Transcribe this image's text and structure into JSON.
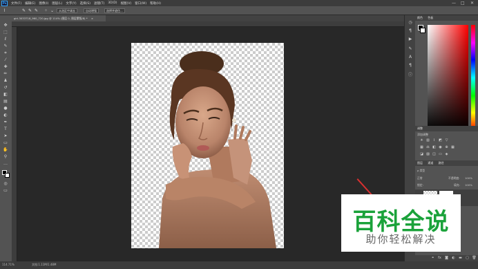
{
  "app": {
    "logo": "Ps",
    "menu": [
      "文件(F)",
      "编辑(E)",
      "图像(I)",
      "图层(L)",
      "文字(Y)",
      "选择(S)",
      "滤镜(T)",
      "3D(D)",
      "视图(V)",
      "窗口(W)",
      "帮助(H)"
    ],
    "window_controls": [
      "—",
      "□",
      "✕"
    ]
  },
  "options_bar": {
    "feather_label": "羽化:",
    "btn_subtract": "从选区中减去",
    "btn_auto": "自动增强",
    "btn_refine": "选择并遮住..."
  },
  "document": {
    "tab_label": "girl-3033718_960_720.jpg @ 114% (图层 0, 图层蒙版/8) *",
    "tab_close": "×"
  },
  "status": {
    "zoom": "114.71%",
    "doc_info": "文档:1.11M/1.48M"
  },
  "panels": {
    "color": {
      "tabs": [
        "颜色",
        "色板"
      ]
    },
    "adjustments": {
      "tabs": [
        "调整"
      ],
      "subtitle": "添加调整"
    },
    "layers": {
      "tabs": [
        "图层",
        "通道",
        "路径"
      ],
      "kind_label": "ρ 类型",
      "blend_mode": "正常",
      "opacity_label": "不透明度:",
      "opacity_value": "100%",
      "lock_label": "锁定:",
      "fill_label": "填充:",
      "fill_value": "100%"
    }
  },
  "watermark": {
    "main": "百科全说",
    "sub": "助你轻松解决"
  },
  "colors": {
    "watermark_green": "#1aa23a",
    "arrow_red": "#d83030",
    "ps_blue": "#31a8ff"
  },
  "icons": {
    "tools": [
      "move-icon",
      "marquee-icon",
      "lasso-icon",
      "quick-select-icon",
      "crop-icon",
      "eyedropper-icon",
      "healing-icon",
      "brush-icon",
      "stamp-icon",
      "history-brush-icon",
      "eraser-icon",
      "gradient-icon",
      "blur-icon",
      "dodge-icon",
      "pen-icon",
      "type-icon",
      "path-select-icon",
      "rectangle-icon",
      "hand-icon",
      "zoom-icon"
    ]
  }
}
